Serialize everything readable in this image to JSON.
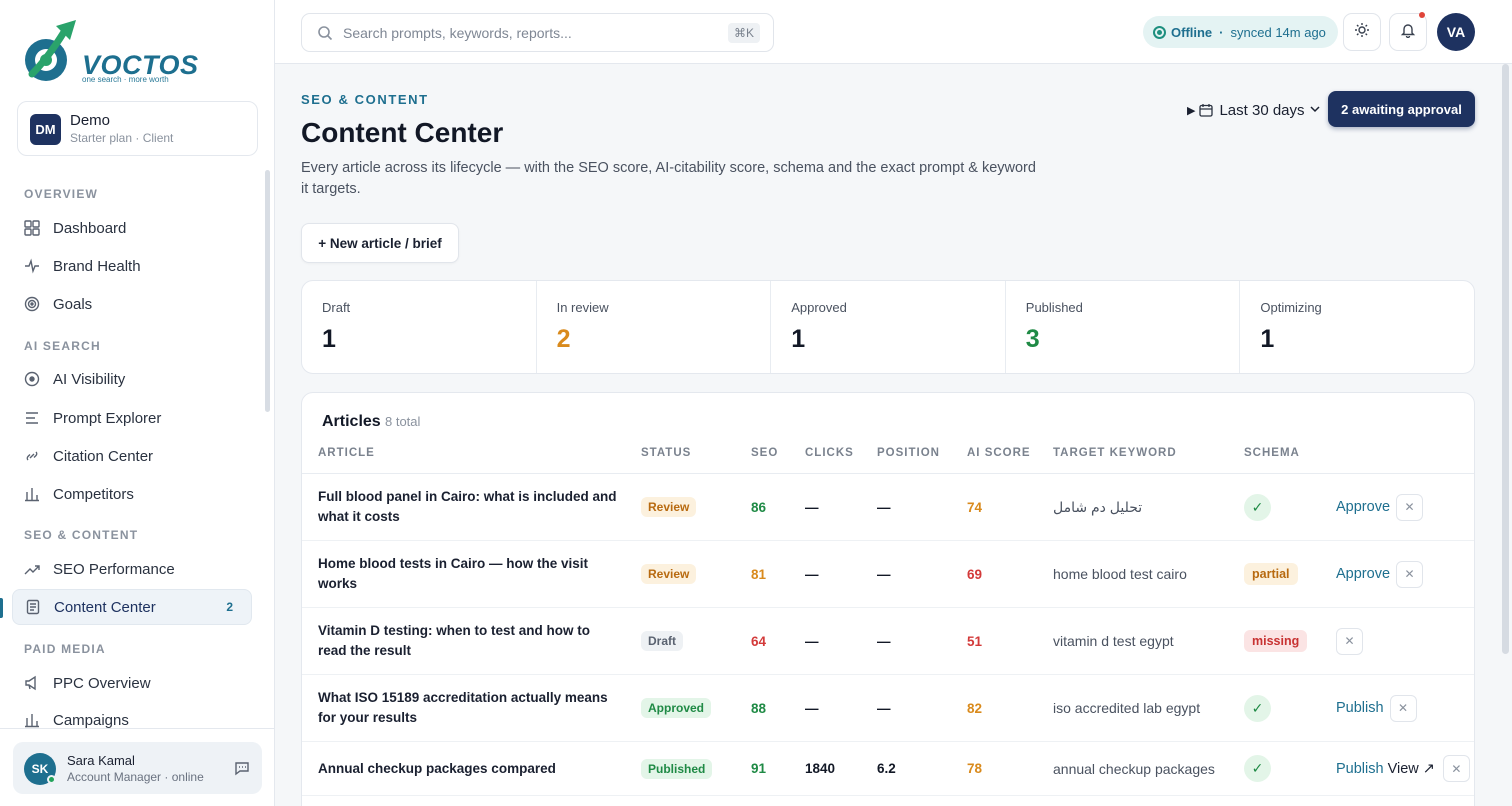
{
  "brand": {
    "name": "VOCTOS",
    "tagline": "one search · more worth"
  },
  "workspace": {
    "initials": "DM",
    "name": "Demo",
    "plan": "Starter plan · Client"
  },
  "nav": {
    "sections": [
      {
        "title": "OVERVIEW",
        "items": [
          {
            "label": "Dashboard",
            "icon": "grid-icon"
          },
          {
            "label": "Brand Health",
            "icon": "pulse-icon"
          },
          {
            "label": "Goals",
            "icon": "target-icon"
          }
        ]
      },
      {
        "title": "AI SEARCH",
        "items": [
          {
            "label": "AI Visibility",
            "icon": "eye-icon"
          },
          {
            "label": "Prompt Explorer",
            "icon": "lines-icon"
          },
          {
            "label": "Citation Center",
            "icon": "link-icon"
          },
          {
            "label": "Competitors",
            "icon": "bars-icon"
          }
        ]
      },
      {
        "title": "SEO & CONTENT",
        "items": [
          {
            "label": "SEO Performance",
            "icon": "trend-icon"
          },
          {
            "label": "Content Center",
            "icon": "document-icon",
            "badge": "2",
            "active": true
          }
        ]
      },
      {
        "title": "PAID MEDIA",
        "items": [
          {
            "label": "PPC Overview",
            "icon": "megaphone-icon"
          },
          {
            "label": "Campaigns",
            "icon": "bars-icon"
          }
        ]
      }
    ]
  },
  "user": {
    "initials": "SK",
    "name": "Sara Kamal",
    "role": "Account Manager · online"
  },
  "topbar": {
    "search_placeholder": "Search prompts, keywords, reports...",
    "shortcut": "⌘K",
    "status": "Offline",
    "separator": "·",
    "synced": "synced 14m ago",
    "avatar": "VA"
  },
  "page": {
    "eyebrow": "SEO & CONTENT",
    "title": "Content Center",
    "description": "Every article across its lifecycle — with the SEO score, AI-citability score, schema and the exact prompt & keyword it targets.",
    "date_range": "Last 30 days",
    "approval_button": "2 awaiting approval",
    "new_button": "+ New article / brief"
  },
  "stats": [
    {
      "label": "Draft",
      "value": "1",
      "color": "#121826"
    },
    {
      "label": "In review",
      "value": "2",
      "color": "#d98a1c"
    },
    {
      "label": "Approved",
      "value": "1",
      "color": "#121826"
    },
    {
      "label": "Published",
      "value": "3",
      "color": "#1f8a45"
    },
    {
      "label": "Optimizing",
      "value": "1",
      "color": "#121826"
    }
  ],
  "articles": {
    "title": "Articles",
    "count": "8 total",
    "columns": [
      "ARTICLE",
      "STATUS",
      "SEO",
      "CLICKS",
      "POSITION",
      "AI SCORE",
      "TARGET KEYWORD",
      "SCHEMA"
    ],
    "rows": [
      {
        "title": "Full blood panel in Cairo: what is included and what it costs",
        "status": "Review",
        "seo": "86",
        "clicks": "—",
        "position": "—",
        "ai": "74",
        "keyword": "تحليل دم شامل",
        "schema": "check",
        "actions": [
          "Approve"
        ]
      },
      {
        "title": "Home blood tests in Cairo — how the visit works",
        "status": "Review",
        "seo": "81",
        "clicks": "—",
        "position": "—",
        "ai": "69",
        "keyword": "home blood test cairo",
        "schema": "partial",
        "actions": [
          "Approve"
        ]
      },
      {
        "title": "Vitamin D testing: when to test and how to read the result",
        "status": "Draft",
        "seo": "64",
        "clicks": "—",
        "position": "—",
        "ai": "51",
        "keyword": "vitamin d test egypt",
        "schema": "missing",
        "actions": []
      },
      {
        "title": "What ISO 15189 accreditation actually means for your results",
        "status": "Approved",
        "seo": "88",
        "clicks": "—",
        "position": "—",
        "ai": "82",
        "keyword": "iso accredited lab egypt",
        "schema": "check",
        "actions": [
          "Publish"
        ]
      },
      {
        "title": "Annual checkup packages compared",
        "status": "Published",
        "seo": "91",
        "clicks": "1840",
        "position": "6.2",
        "ai": "78",
        "keyword": "annual checkup packages",
        "schema": "check",
        "actions": [
          "Publish",
          "View ↗"
        ]
      }
    ]
  },
  "colors": {
    "accent": "#1e6f8f",
    "navy": "#1e3260",
    "green": "#1f8a45",
    "orange": "#d98a1c",
    "red": "#d33a3a"
  }
}
